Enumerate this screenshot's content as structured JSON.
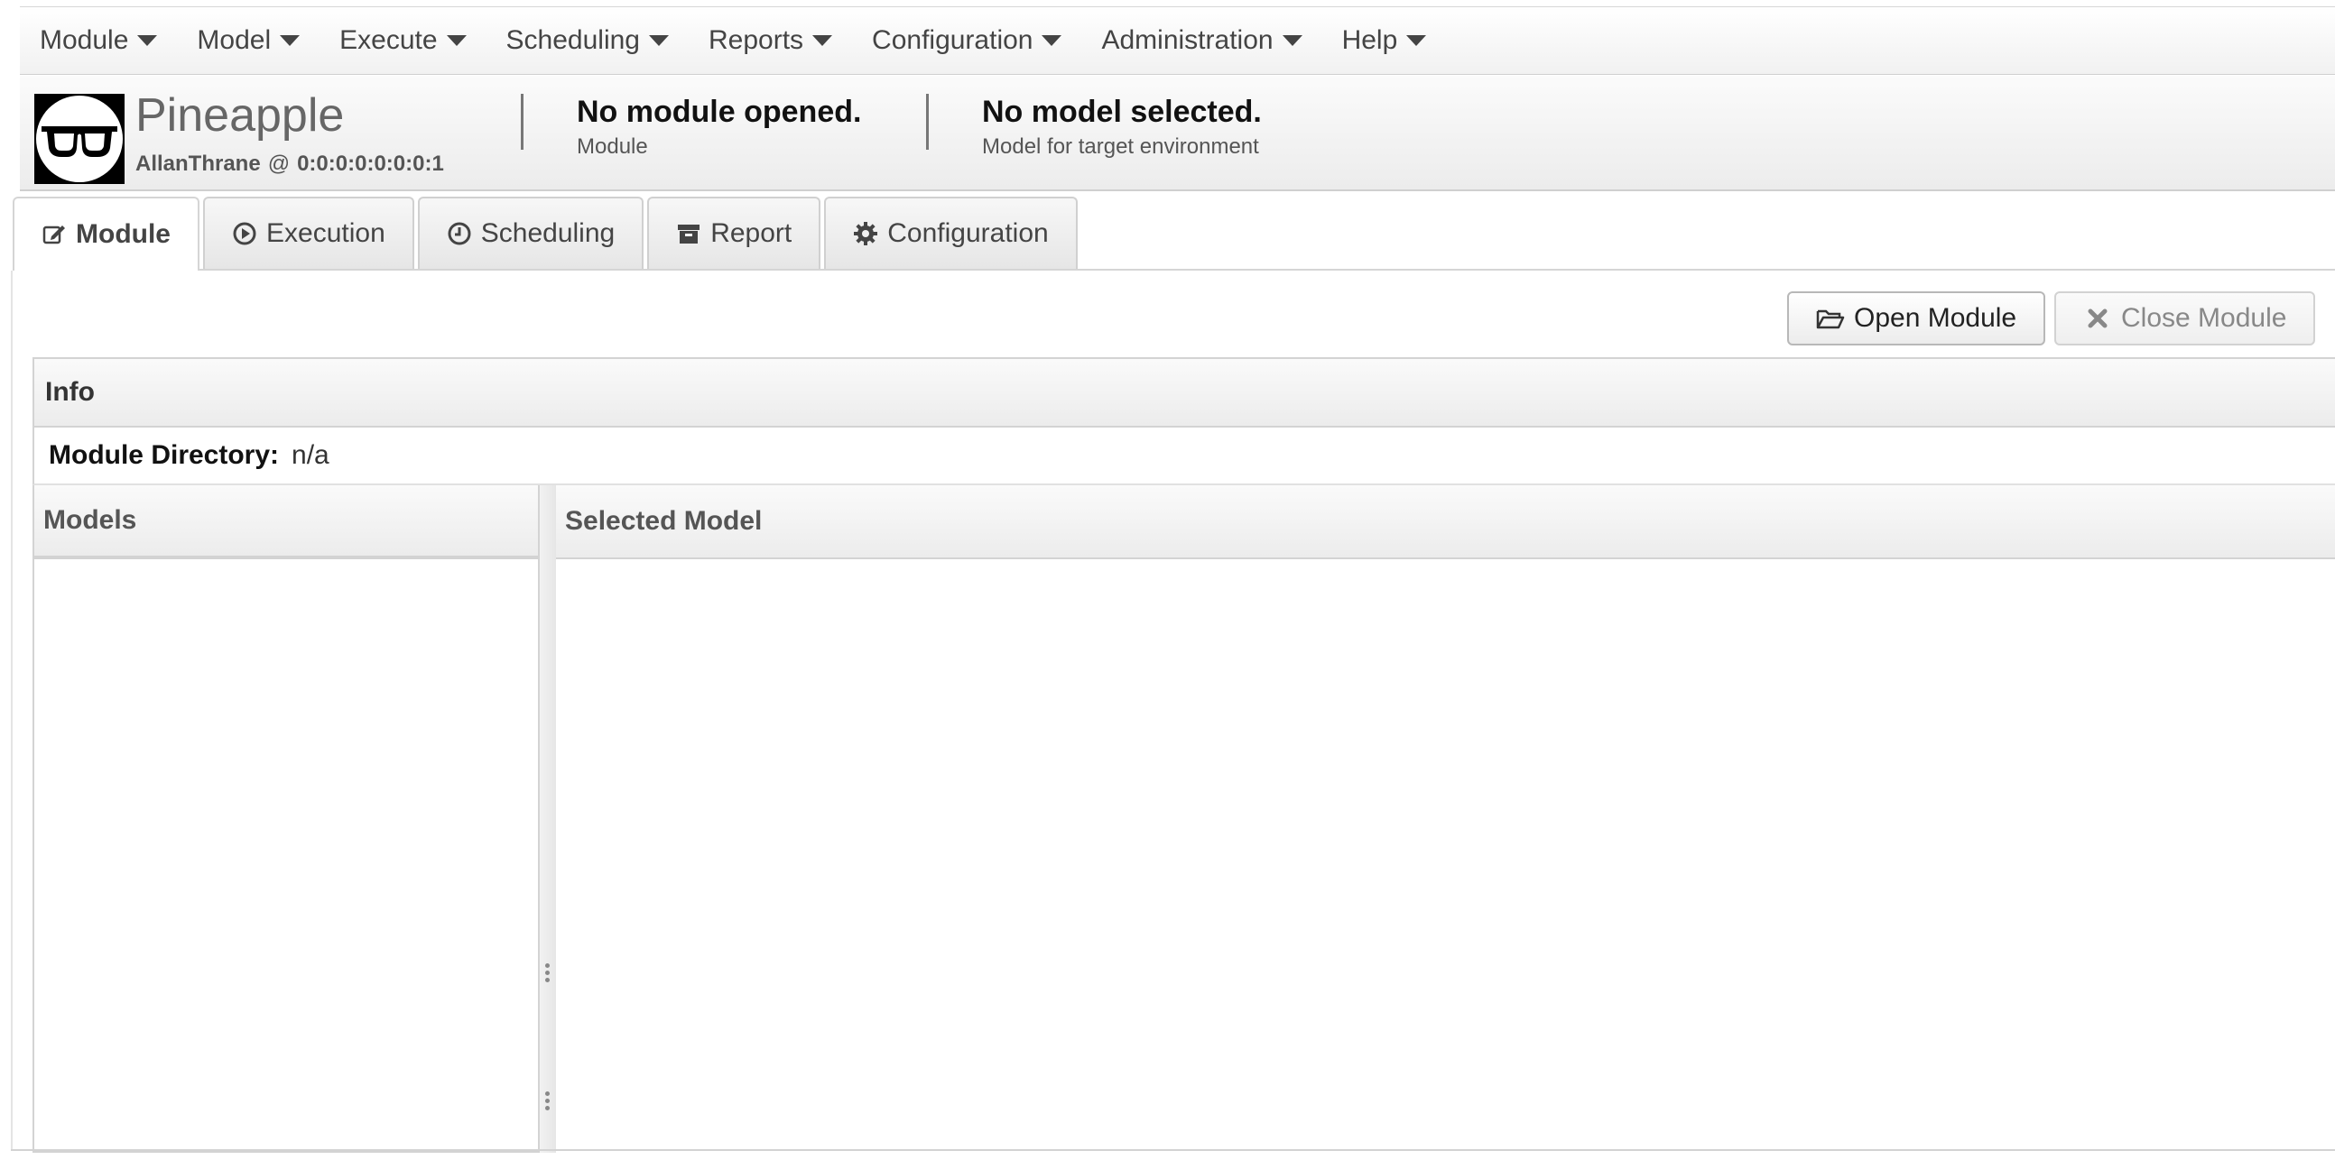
{
  "menu": {
    "items": [
      {
        "label": "Module"
      },
      {
        "label": "Model"
      },
      {
        "label": "Execute"
      },
      {
        "label": "Scheduling"
      },
      {
        "label": "Reports"
      },
      {
        "label": "Configuration"
      },
      {
        "label": "Administration"
      },
      {
        "label": "Help"
      }
    ]
  },
  "header": {
    "app_name": "Pineapple",
    "user": "AllanThrane",
    "at": "@",
    "host": "0:0:0:0:0:0:0:1",
    "module_status": "No module opened.",
    "module_caption": "Module",
    "model_status": "No model selected.",
    "model_caption": "Model for target environment"
  },
  "tabs": [
    {
      "label": "Module",
      "icon": "edit-icon",
      "active": true
    },
    {
      "label": "Execution",
      "icon": "play-circle-icon",
      "active": false
    },
    {
      "label": "Scheduling",
      "icon": "clock-icon",
      "active": false
    },
    {
      "label": "Report",
      "icon": "archive-icon",
      "active": false
    },
    {
      "label": "Configuration",
      "icon": "gear-icon",
      "active": false
    }
  ],
  "toolbar": {
    "open_label": "Open Module",
    "close_label": "Close Module"
  },
  "info": {
    "title": "Info",
    "directory_label": "Module Directory:",
    "directory_value": "n/a"
  },
  "panes": {
    "models_title": "Models",
    "selected_title": "Selected Model"
  },
  "colors": {
    "menu_text": "#444444",
    "disabled_text": "#888888",
    "panel_border": "#d3d3d3"
  }
}
